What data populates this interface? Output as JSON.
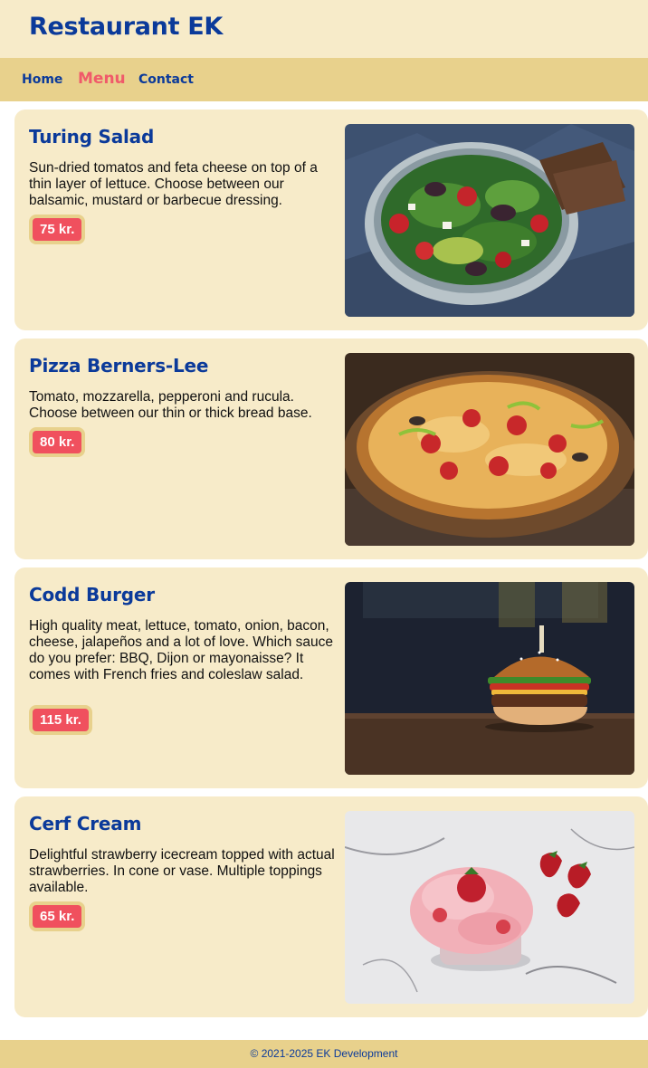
{
  "site": {
    "title": "Restaurant EK"
  },
  "nav": {
    "items": [
      {
        "label": "Home"
      },
      {
        "label": "Menu"
      },
      {
        "label": "Contact"
      }
    ]
  },
  "menu": {
    "items": [
      {
        "name": "Turing Salad",
        "description": "Sun-dried tomatos and feta cheese on top of a thin layer of lettuce. Choose between our balsamic, mustard or barbecue dressing.",
        "price": "75 kr.",
        "image_icon": "salad-photo"
      },
      {
        "name": "Pizza Berners-Lee",
        "description": "Tomato, mozzarella, pepperoni and rucula. Choose between our thin or thick bread base.",
        "price": "80 kr.",
        "image_icon": "pizza-photo"
      },
      {
        "name": "Codd Burger",
        "description": "High quality meat, lettuce, tomato, onion, bacon, cheese, jalapeños and a lot of love. Which sauce do you prefer: BBQ, Dijon or mayonaisse? It comes with French fries and coleslaw salad.",
        "price": "115 kr.",
        "image_icon": "burger-photo"
      },
      {
        "name": "Cerf Cream",
        "description": "Delightful strawberry icecream topped with actual strawberries. In cone or vase. Multiple toppings available.",
        "price": "65 kr.",
        "image_icon": "icecream-photo"
      }
    ]
  },
  "footer": {
    "text": "© 2021-2025 EK Development"
  },
  "colors": {
    "brand_blue": "#0b3a9a",
    "header_bg": "#f7ebc9",
    "nav_bg": "#e8d18c",
    "active_link": "#f05a6a",
    "price_bg": "#f0505e"
  }
}
